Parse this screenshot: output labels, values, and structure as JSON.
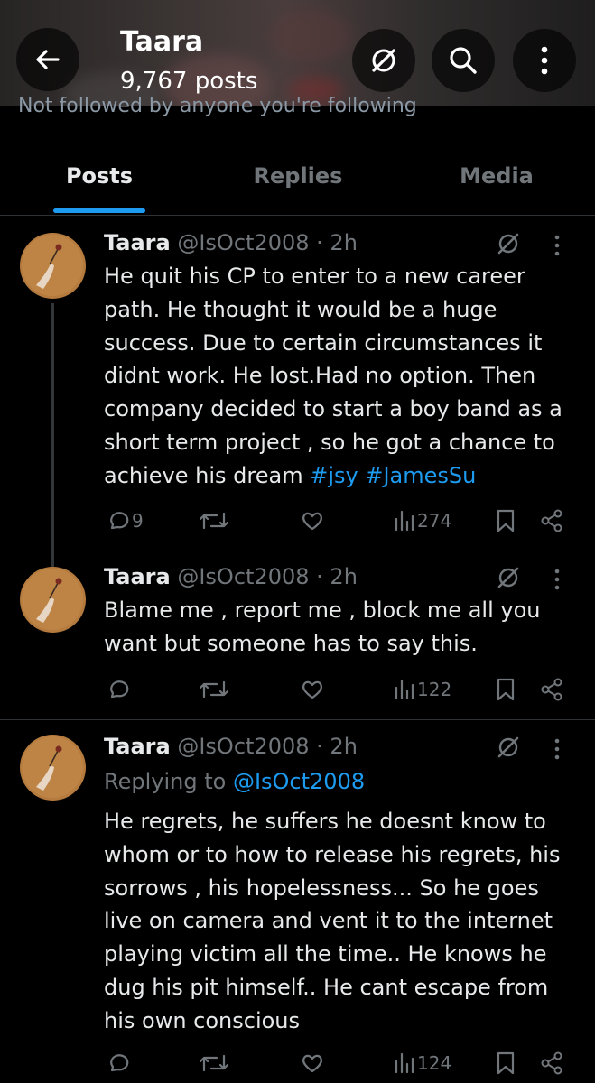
{
  "header": {
    "name": "Taara",
    "post_count": "9,767 posts",
    "followed_note": "Not followed by anyone you're following",
    "icons": [
      "back-arrow-icon",
      "grok-icon",
      "search-icon",
      "more-vertical-icon"
    ]
  },
  "tabs": [
    {
      "label": "Posts",
      "active": true
    },
    {
      "label": "Replies",
      "active": false
    },
    {
      "label": "Media",
      "active": false
    }
  ],
  "colors": {
    "background": "#000000",
    "text_primary": "#e7e9ea",
    "text_secondary": "#71767b",
    "accent": "#1d9bf0",
    "divider": "#2f3336"
  },
  "posts": [
    {
      "author": "Taara",
      "handle": "@IsOct2008",
      "dot": "·",
      "time": "2h",
      "text": "He quit his CP to enter to a new career path. He thought it would be a huge success. Due to certain circumstances it didnt work. He lost.Had no option. Then company decided to start a boy band as a short term  project , so he got a chance to achieve his dream",
      "hashtags": [
        "#jsy",
        "#JamesSu"
      ],
      "replies": "9",
      "retweets": "",
      "likes": "",
      "views": "274"
    },
    {
      "author": "Taara",
      "handle": "@IsOct2008",
      "dot": "·",
      "time": "2h",
      "text": "Blame me , report me , block me all you want but someone has to say this.",
      "replies": "",
      "retweets": "",
      "likes": "",
      "views": "122"
    },
    {
      "author": "Taara",
      "handle": "@IsOct2008",
      "dot": "·",
      "time": "2h",
      "replying_prefix": "Replying to",
      "replying_to": "@IsOct2008",
      "text": "He regrets, he suffers he doesnt know to whom or to how to release his regrets, his sorrows , his hopelessness... So he goes live on camera and vent it to the internet playing victim all the time..  He knows he dug his pit himself.. He cant escape from his own conscious",
      "replies": "",
      "retweets": "",
      "likes": "",
      "views": "124"
    }
  ]
}
